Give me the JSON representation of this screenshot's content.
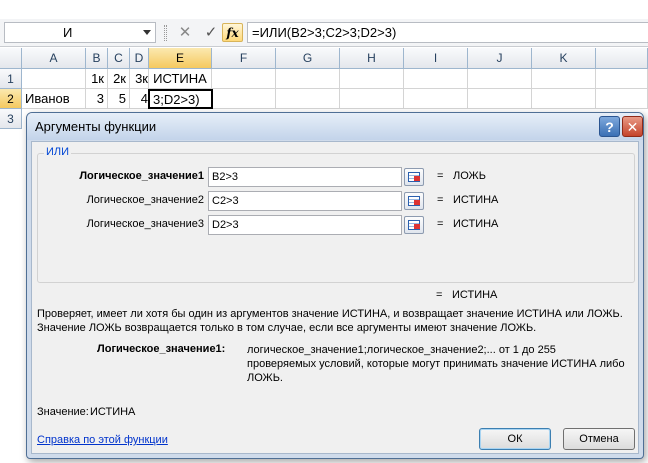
{
  "formula_bar": {
    "name_box": "И",
    "cancel_glyph": "✕",
    "enter_glyph": "✓",
    "fx_label": "fx",
    "formula": "=ИЛИ(B2>3;C2>3;D2>3)"
  },
  "sheet": {
    "columns": [
      "A",
      "B",
      "C",
      "D",
      "E",
      "F",
      "G",
      "H",
      "I",
      "J",
      "K"
    ],
    "rows": [
      {
        "num": "1",
        "A": "",
        "B": "1к",
        "C": "2к",
        "D": "3к",
        "E": "ИСТИНА"
      },
      {
        "num": "2",
        "A": "Иванов",
        "B": "3",
        "C": "5",
        "D": "4",
        "E": "3;D2>3)"
      },
      {
        "num": "3"
      }
    ]
  },
  "dialog": {
    "title": "Аргументы функции",
    "help_glyph": "?",
    "close_glyph": "✕",
    "function_name": "ИЛИ",
    "args": [
      {
        "label": "Логическое_значение1",
        "value": "B2>3",
        "result": "ЛОЖЬ"
      },
      {
        "label": "Логическое_значение2",
        "value": "C2>3",
        "result": "ИСТИНА"
      },
      {
        "label": "Логическое_значение3",
        "value": "D2>3",
        "result": "ИСТИНА"
      }
    ],
    "eq": "=",
    "overall_result": "ИСТИНА",
    "description": "Проверяет, имеет ли хотя бы один из аргументов значение ИСТИНА, и возвращает значение ИСТИНА или ЛОЖЬ. Значение ЛОЖЬ возвращается только в том случае, если все аргументы имеют значение ЛОЖЬ.",
    "param_name": "Логическое_значение1:",
    "param_desc": "логическое_значение1;логическое_значение2;... от 1 до 255 проверяемых условий, которые могут принимать значение ИСТИНА либо ЛОЖЬ.",
    "value_label": "Значение:",
    "value_result": "ИСТИНА",
    "help_link": "Справка по этой функции",
    "ok": "ОК",
    "cancel": "Отмена"
  }
}
